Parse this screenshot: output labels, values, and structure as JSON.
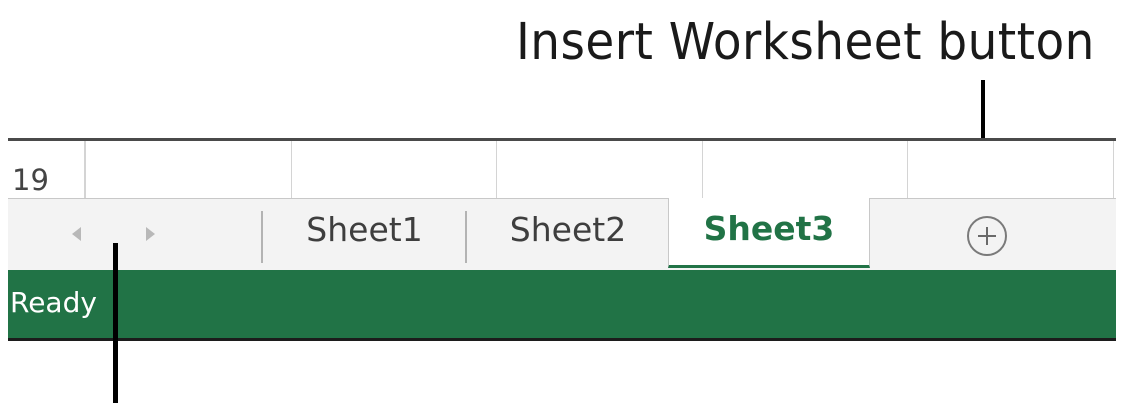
{
  "callout": {
    "label": "Insert Worksheet button"
  },
  "grid": {
    "row_number": "19"
  },
  "tabs": [
    {
      "label": "Sheet1",
      "active": false
    },
    {
      "label": "Sheet2",
      "active": false
    },
    {
      "label": "Sheet3",
      "active": true
    }
  ],
  "icons": {
    "scroll_left": "chevron-left-icon",
    "scroll_right": "chevron-right-icon",
    "add_sheet": "plus-circle-icon"
  },
  "status_bar": {
    "text": "Ready"
  },
  "colors": {
    "accent": "#217346",
    "tab_bar_bg": "#f3f3f3",
    "inactive_tab_text": "#3e3e3e"
  }
}
